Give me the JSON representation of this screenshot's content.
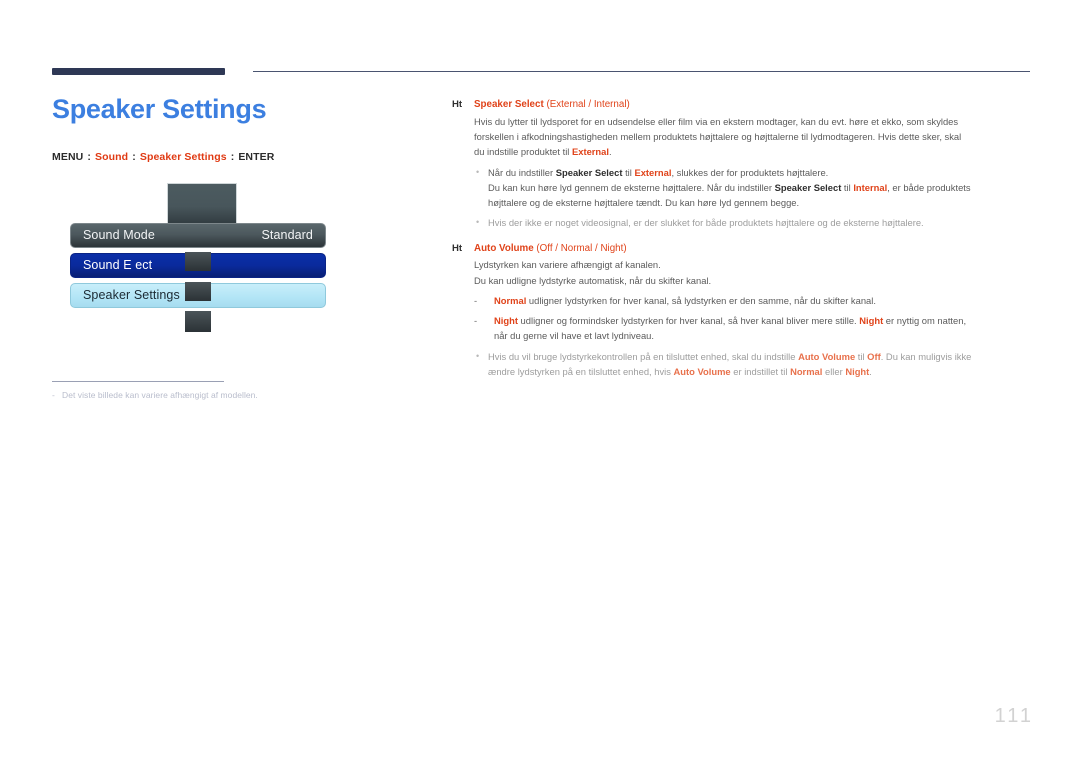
{
  "page": {
    "title": "Speaker Settings",
    "page_number": "111"
  },
  "breadcrumb": {
    "menu": "MENU",
    "sep": ":",
    "item1": "Sound",
    "item2": "Speaker Settings",
    "enter": "ENTER"
  },
  "osd": {
    "rows": [
      {
        "label": "Sound Mode",
        "value": "Standard"
      },
      {
        "label": "Sound E ect",
        "value": ""
      },
      {
        "label": "Speaker Settings",
        "value": ""
      }
    ]
  },
  "footnote": {
    "dash": "-",
    "text": "Det viste billede kan variere afhængigt af modellen."
  },
  "sections": [
    {
      "marker": "Ht",
      "title": "Speaker Select",
      "options": "(External / Internal)",
      "paragraph_1": "Hvis du lytter til lydsporet for en udsendelse eller film via en ekstern modtager, kan du evt. høre et ekko, som skyldes",
      "paragraph_2": "forskellen i afkodningshastigheden mellem produktets højttalere og højttalerne til lydmodtageren. Hvis dette sker, skal",
      "paragraph_3_pre": "du indstille produktet til ",
      "paragraph_3_key": "External",
      "paragraph_3_post": ".",
      "bullet_1_a": "Når du indstiller ",
      "bullet_1_k1": "Speaker Select",
      "bullet_1_b": " til ",
      "bullet_1_k2": "External",
      "bullet_1_c": ", slukkes der for produktets højttalere.",
      "bullet_1_line2_a": "Du kan kun høre lyd gennem de eksterne højttalere. Når du indstiller ",
      "bullet_1_line2_k1": "Speaker Select",
      "bullet_1_line2_b": " til ",
      "bullet_1_line2_k2": "Internal",
      "bullet_1_line2_c": ", er både produktets",
      "bullet_1_line3": "højttalere og de eksterne højttalere tændt. Du kan høre lyd gennem begge.",
      "bullet_2": "Hvis der ikke er noget videosignal, er der slukket for både produktets højttalere og de eksterne højttalere."
    },
    {
      "marker": "Ht",
      "title": "Auto Volume",
      "options": "(Off / Normal / Night)",
      "paragraph_1": "Lydstyrken kan variere afhængigt af kanalen.",
      "paragraph_2": "Du kan udligne lydstyrke automatisk, når du skifter kanal.",
      "dash_1_key": "Normal",
      "dash_1_text": " udligner lydstyrken for hver kanal, så lydstyrken er den samme, når du skifter kanal.",
      "dash_2_k1": "Night",
      "dash_2_a": " udligner og formindsker lydstyrken for hver kanal, så hver kanal bliver mere stille. ",
      "dash_2_k2": "Night",
      "dash_2_b": " er nyttig om natten,",
      "dash_2_line2": "når du gerne vil have et lavt lydniveau.",
      "bullet_1_a": "Hvis du vil bruge lydstyrkekontrollen på en tilsluttet enhed, skal du indstille ",
      "bullet_1_k1": "Auto Volume",
      "bullet_1_b": " til ",
      "bullet_1_k2": "Off",
      "bullet_1_c": ". Du kan muligvis ikke",
      "bullet_1_line2_a": "ændre lydstyrken på en tilsluttet enhed, hvis ",
      "bullet_1_line2_k1": "Auto Volume",
      "bullet_1_line2_b": " er indstillet til ",
      "bullet_1_line2_k2": "Normal",
      "bullet_1_line2_c": " eller ",
      "bullet_1_line2_k3": "Night",
      "bullet_1_line2_d": "."
    }
  ],
  "icons": {
    "section_marker": "section-marker-icon",
    "sub_bullet": "sub-bullet-icon",
    "dash_bullet": "dash-bullet-icon"
  },
  "colors": {
    "title_blue": "#3c7fe0",
    "keyword_red": "#e0431a",
    "rule_navy": "#2e3855",
    "osd_highlight": "#b2e5f6",
    "osd_selected_blue": "#0a2a9c"
  }
}
